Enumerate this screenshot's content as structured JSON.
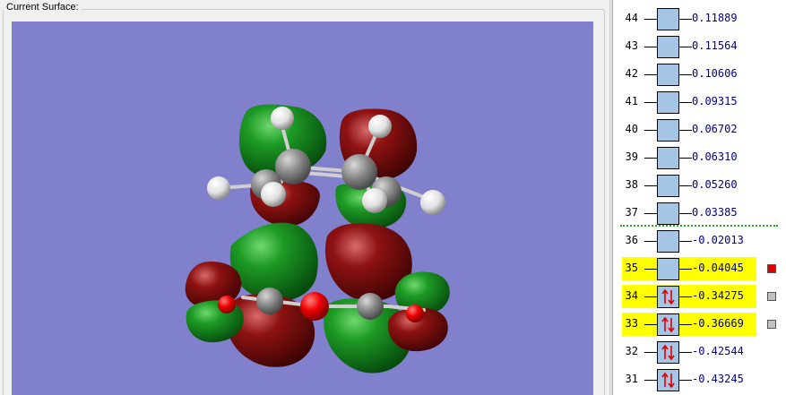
{
  "surface_panel": {
    "label": "Current Surface:",
    "background_color": "#8080cd"
  },
  "orbitals": [
    {
      "number": "44",
      "energy": "0.11889",
      "occupied": false,
      "highlighted": false,
      "marker_color": null
    },
    {
      "number": "43",
      "energy": "0.11564",
      "occupied": false,
      "highlighted": false,
      "marker_color": null
    },
    {
      "number": "42",
      "energy": "0.10606",
      "occupied": false,
      "highlighted": false,
      "marker_color": null
    },
    {
      "number": "41",
      "energy": "0.09315",
      "occupied": false,
      "highlighted": false,
      "marker_color": null
    },
    {
      "number": "40",
      "energy": "0.06702",
      "occupied": false,
      "highlighted": false,
      "marker_color": null
    },
    {
      "number": "39",
      "energy": "0.06310",
      "occupied": false,
      "highlighted": false,
      "marker_color": null
    },
    {
      "number": "38",
      "energy": "0.05260",
      "occupied": false,
      "highlighted": false,
      "marker_color": null
    },
    {
      "number": "37",
      "energy": "0.03385",
      "occupied": false,
      "highlighted": false,
      "marker_color": null
    },
    {
      "number": "36",
      "energy": "-0.02013",
      "occupied": false,
      "highlighted": false,
      "marker_color": null
    },
    {
      "number": "35",
      "energy": "-0.04045",
      "occupied": false,
      "highlighted": true,
      "marker_color": "#e00000"
    },
    {
      "number": "34",
      "energy": "-0.34275",
      "occupied": true,
      "highlighted": true,
      "marker_color": "#c0c0c0"
    },
    {
      "number": "33",
      "energy": "-0.36669",
      "occupied": true,
      "highlighted": true,
      "marker_color": "#c0c0c0"
    },
    {
      "number": "32",
      "energy": "-0.42544",
      "occupied": true,
      "highlighted": false,
      "marker_color": null
    },
    {
      "number": "31",
      "energy": "-0.43245",
      "occupied": true,
      "highlighted": false,
      "marker_color": null
    }
  ],
  "colors": {
    "highlight": "#ffff00",
    "orbital_box": "#a6c4e3",
    "energy_text": "#000080",
    "separator": "#17b417",
    "positive_lobe": "#0f7a1a",
    "negative_lobe": "#7a0a0a",
    "carbon": "#8a8a8a",
    "hydrogen": "#e8e8e8",
    "oxygen": "#e00000"
  }
}
